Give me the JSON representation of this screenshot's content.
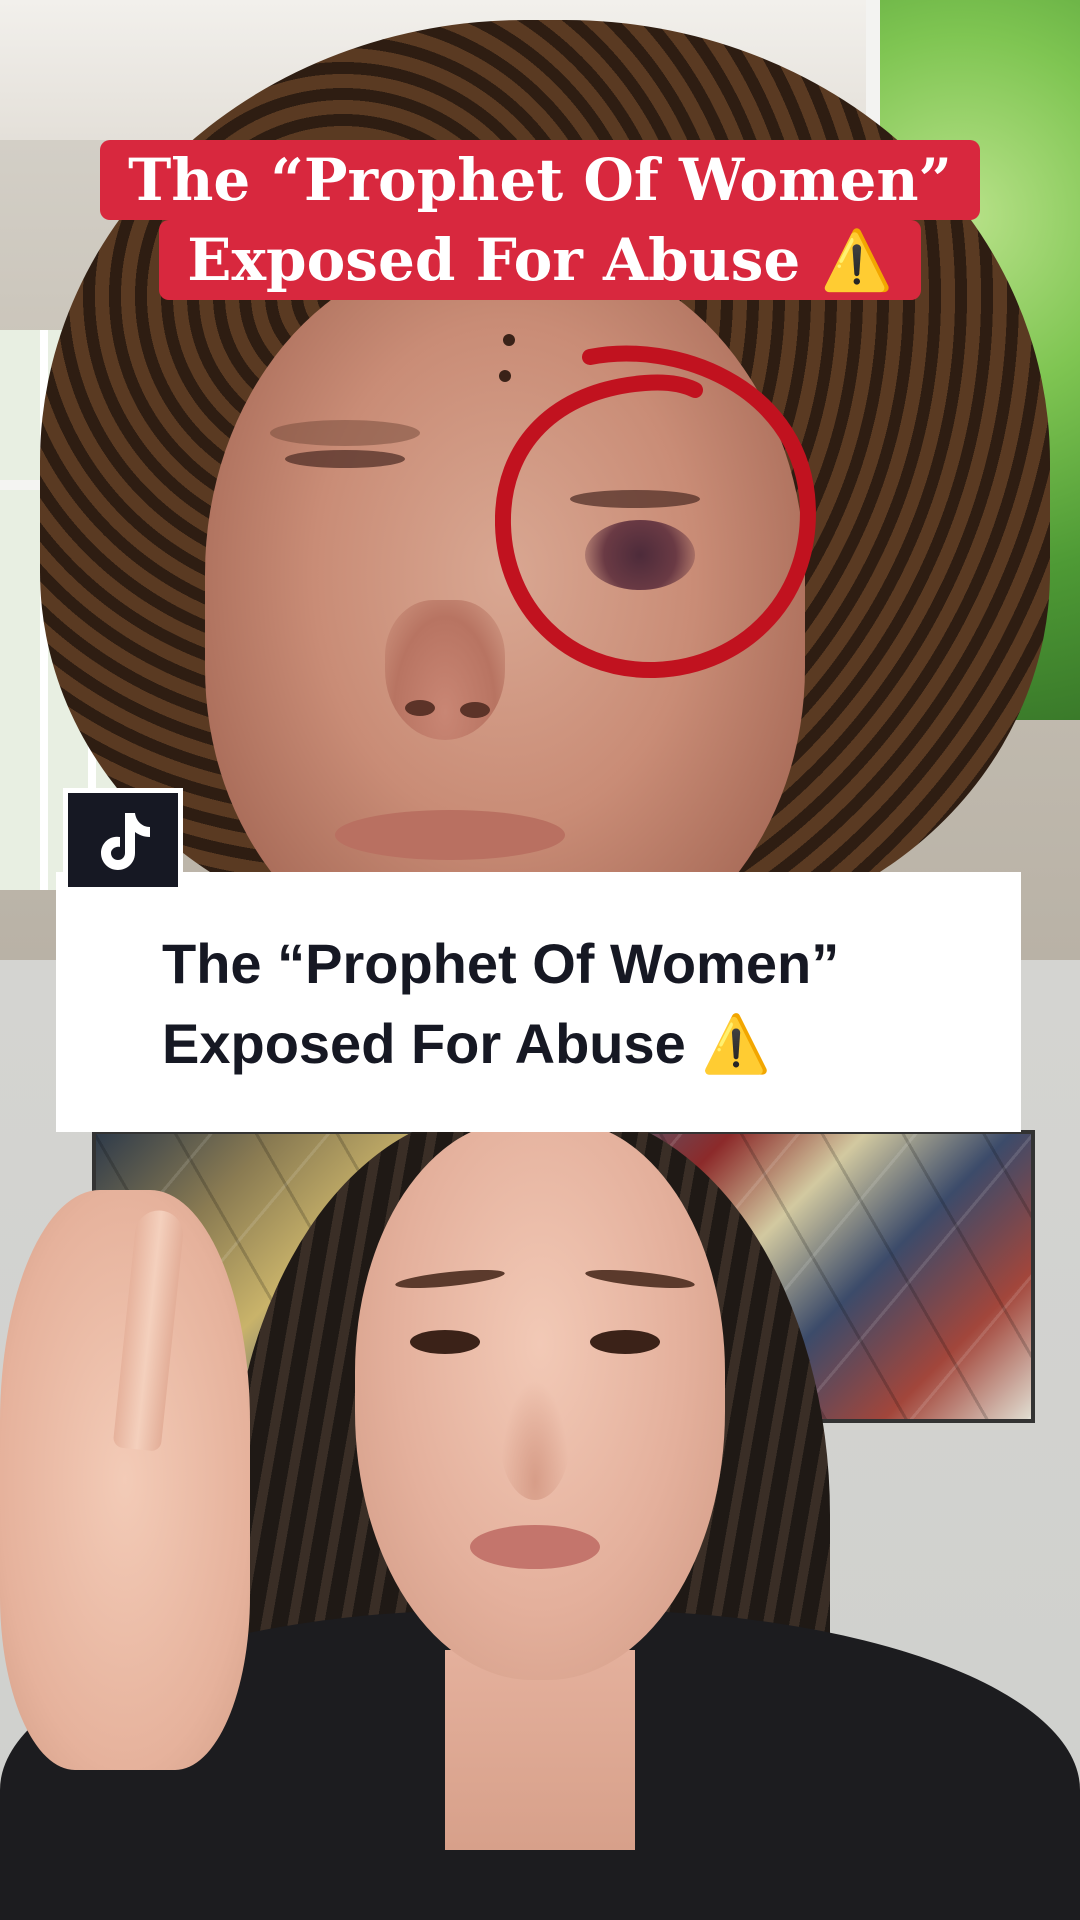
{
  "top_video": {
    "caption_line1": "The “Prophet Of Women”",
    "caption_line2": "Exposed For Abuse ⚠️",
    "caption_bg_color": "#d8283e",
    "annotation_color": "#c1121f"
  },
  "stitch_card": {
    "line1": "The “Prophet Of Women”",
    "line2": "Exposed For Abuse ⚠️",
    "text_color": "#161823"
  },
  "badge": {
    "icon": "tiktok-logo-icon"
  }
}
